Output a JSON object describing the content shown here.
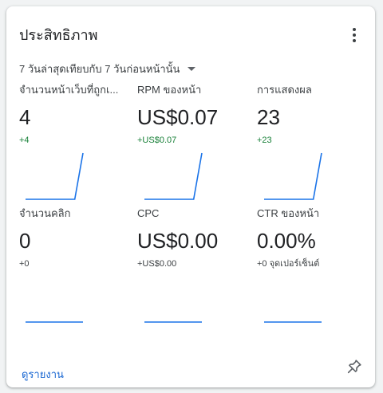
{
  "card": {
    "title": "ประสิทธิภาพ",
    "menu_icon": "more-vert-icon",
    "date_range": "7 วันล่าสุดเทียบกับ 7 วันก่อนหน้านั้น",
    "footer_link": "ดูรายงาน",
    "pin_icon": "pin-icon"
  },
  "colors": {
    "accent": "#1967d2",
    "spark": "#1a73e8",
    "positive": "#188038"
  },
  "metrics": [
    {
      "label": "จำนวนหน้าเว็บที่ถูกเ...",
      "value": "4",
      "delta": "+4",
      "trend": "up",
      "spark": [
        0,
        0,
        0,
        0,
        0,
        0,
        0,
        1
      ]
    },
    {
      "label": "RPM ของหน้า",
      "value": "US$0.07",
      "delta": "+US$0.07",
      "trend": "up",
      "spark": [
        0,
        0,
        0,
        0,
        0,
        0,
        0,
        1
      ]
    },
    {
      "label": "การแสดงผล",
      "value": "23",
      "delta": "+23",
      "trend": "up",
      "spark": [
        0,
        0,
        0,
        0,
        0,
        0,
        0,
        1
      ]
    },
    {
      "label": "จำนวนคลิก",
      "value": "0",
      "delta": "+0",
      "trend": "flat",
      "spark": [
        0,
        0,
        0,
        0,
        0,
        0,
        0,
        0
      ]
    },
    {
      "label": "CPC",
      "value": "US$0.00",
      "delta": "+US$0.00",
      "trend": "flat",
      "spark": [
        0,
        0,
        0,
        0,
        0,
        0,
        0,
        0
      ]
    },
    {
      "label": "CTR ของหน้า",
      "value": "0.00%",
      "delta": "+0 จุดเปอร์เซ็นต์",
      "trend": "flat",
      "spark": [
        0,
        0,
        0,
        0,
        0,
        0,
        0,
        0
      ]
    }
  ]
}
